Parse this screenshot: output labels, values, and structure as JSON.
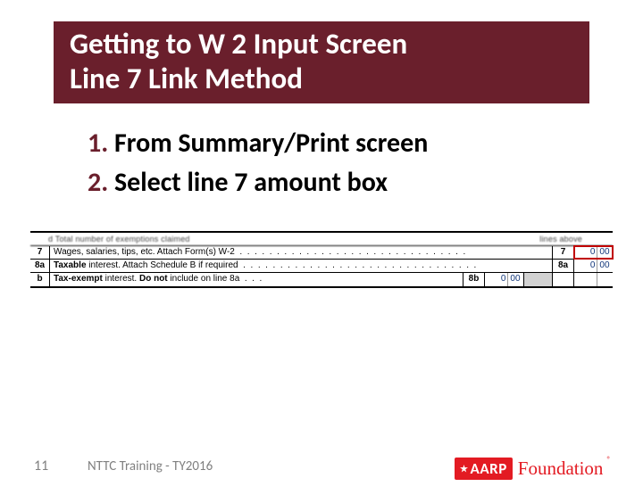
{
  "title": {
    "line1": "Getting to W 2 Input Screen",
    "line2": "Line 7 Link Method"
  },
  "steps": [
    "From Summary/Print screen",
    "Select line 7 amount box"
  ],
  "form": {
    "blur_left": "d   Total number of exemptions claimed",
    "blur_right": "lines above",
    "line7": {
      "num_left": "7",
      "desc": "Wages, salaries, tips, etc. Attach Form(s) W-2",
      "num_right": "7",
      "amount_dollars": "0",
      "amount_cents": "00"
    },
    "line8a": {
      "num_left": "8a",
      "desc_prefix": "Taxable",
      "desc_rest": " interest. Attach Schedule B if required",
      "num_right": "8a",
      "amount_dollars": "0",
      "amount_cents": "00"
    },
    "line8b": {
      "num_left": "b",
      "desc_prefix": "Tax-exempt",
      "desc_mid": " interest. ",
      "desc_bold2": "Do not",
      "desc_end": " include on line 8a",
      "box_label": "8b",
      "amount_dollars": "0",
      "amount_cents": "00"
    }
  },
  "footer": {
    "slide_number": "11",
    "text": "NTTC Training - TY2016",
    "logo_aarp": "AARP",
    "logo_foundation": "Foundation",
    "registered": "®"
  }
}
